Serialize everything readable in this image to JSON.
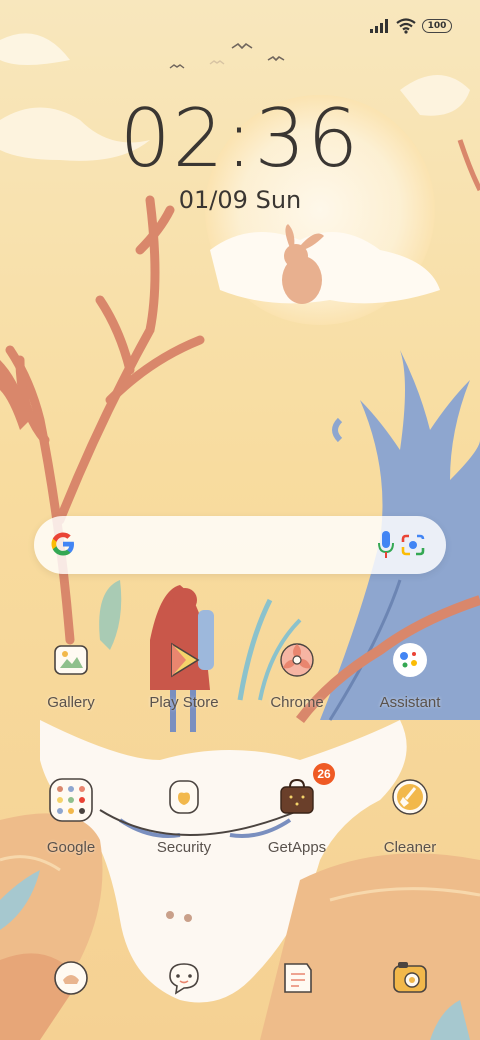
{
  "status_bar": {
    "battery": "100",
    "icons": [
      "signal-icon",
      "wifi-icon",
      "battery-icon"
    ]
  },
  "lockscreen": {
    "time": "02:36",
    "date": "01/09",
    "day": "Sun"
  },
  "search_bar": {
    "icons": [
      "google-logo-icon",
      "microphone-icon",
      "google-lens-icon"
    ]
  },
  "home_apps": {
    "row1": [
      {
        "label": "Gallery",
        "icon": "gallery-icon"
      },
      {
        "label": "Play Store",
        "icon": "play-store-icon"
      },
      {
        "label": "Chrome",
        "icon": "chrome-icon"
      },
      {
        "label": "Assistant",
        "icon": "assistant-icon"
      }
    ],
    "row2": [
      {
        "label": "Google",
        "icon": "google-folder-icon"
      },
      {
        "label": "Security",
        "icon": "security-icon"
      },
      {
        "label": "GetApps",
        "icon": "getapps-icon",
        "badge": "26"
      },
      {
        "label": "Cleaner",
        "icon": "cleaner-icon"
      }
    ]
  },
  "dock": {
    "icons": [
      "phone-icon",
      "messages-icon",
      "notes-icon",
      "camera-icon"
    ]
  },
  "colors": {
    "sky": "#f8dc9f",
    "text": "#3a3632",
    "badge": "#ef5a24"
  }
}
